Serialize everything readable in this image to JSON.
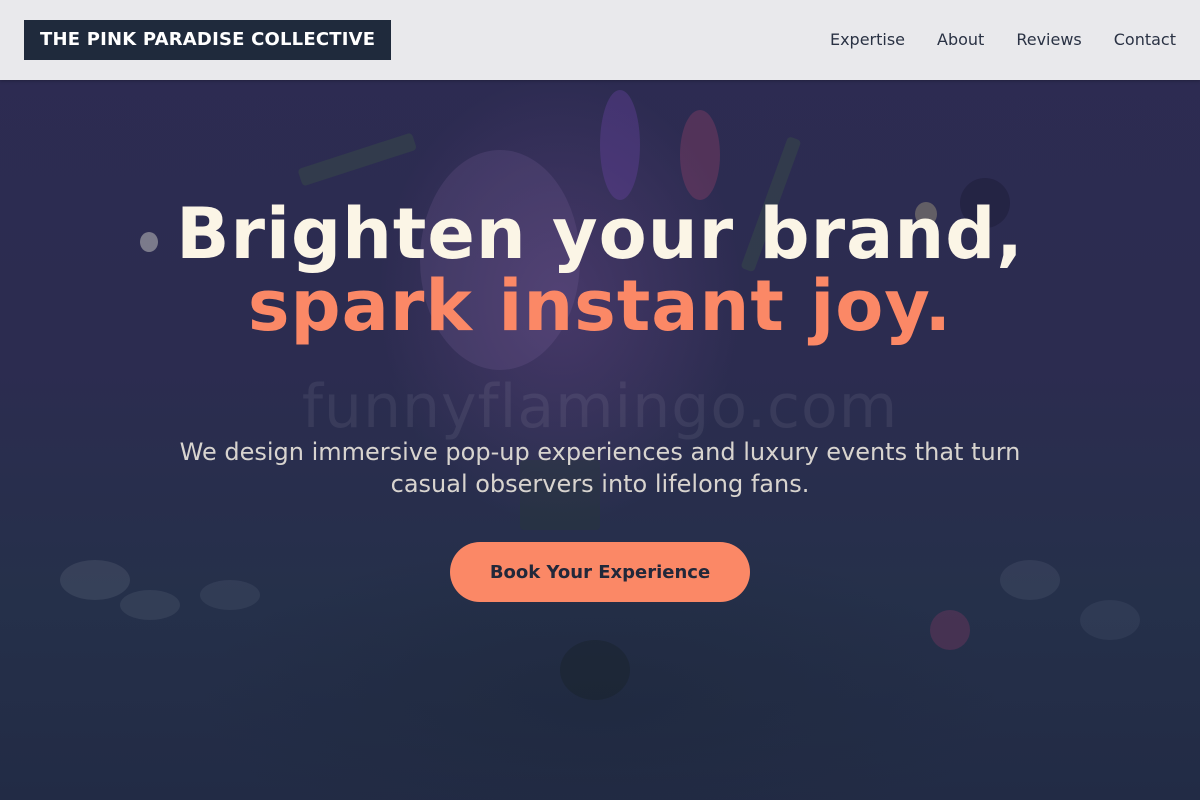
{
  "header": {
    "logo_text": "THE PINK PARADISE COLLECTIVE",
    "nav": [
      {
        "label": "Expertise"
      },
      {
        "label": "About"
      },
      {
        "label": "Reviews"
      },
      {
        "label": "Contact"
      }
    ]
  },
  "hero": {
    "headline_part1": "Brighten your brand, ",
    "headline_accent": "spark instant joy.",
    "subheadline": "We design immersive pop-up experiences and luxury events that turn casual observers into lifelong fans.",
    "cta_label": "Book Your Experience",
    "watermark": "funnyflamingo.com"
  },
  "colors": {
    "accent": "#fb8866",
    "headline": "#fbf5e6",
    "logo_bg": "#1f2a3c",
    "header_bg": "#e9e9ec",
    "hero_bg": "#2c2c50"
  },
  "icons": []
}
